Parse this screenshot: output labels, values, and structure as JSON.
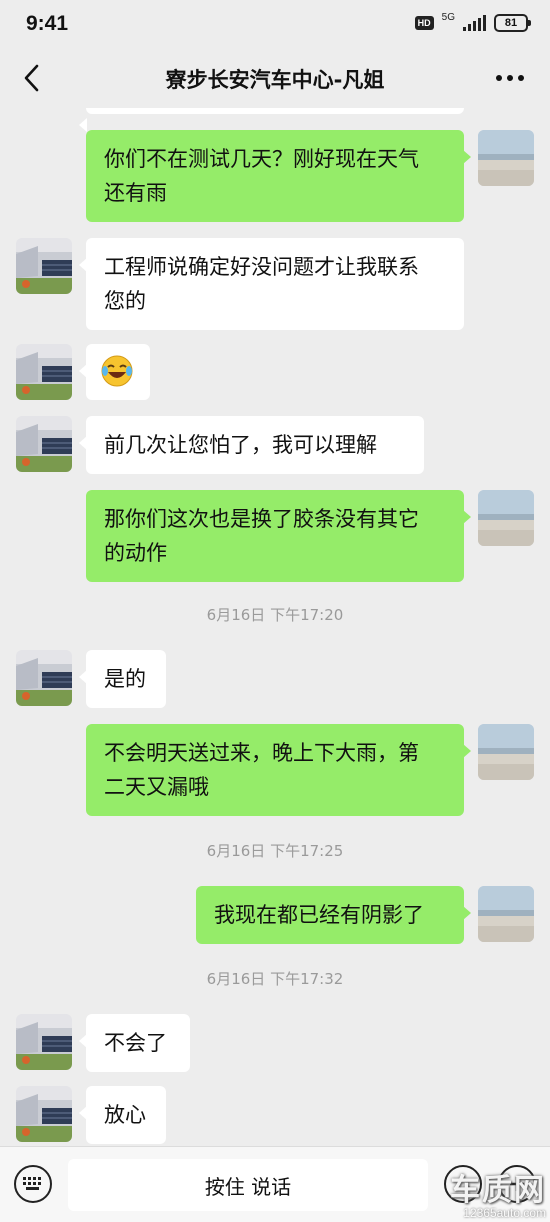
{
  "status_bar": {
    "time": "9:41",
    "hd": "HD",
    "network": "5G",
    "battery": "81"
  },
  "header": {
    "title": "寮步长安汽车中心-凡姐"
  },
  "messages": [
    {
      "dir": "out",
      "lines": [
        "你们不在测试几天？刚好现在天气",
        "还有雨"
      ]
    },
    {
      "dir": "in",
      "lines": [
        "工程师说确定好没问题才让我联系",
        "您的"
      ]
    },
    {
      "dir": "in",
      "lines": [
        "🤣"
      ],
      "emoji": "laughing-crying-emoji"
    },
    {
      "dir": "in",
      "lines": [
        "前几次让您怕了，我可以理解"
      ]
    },
    {
      "dir": "out",
      "lines": [
        "那你们这次也是换了胶条没有其它",
        "的动作"
      ]
    },
    {
      "dir": "in",
      "lines": [
        "是的"
      ]
    },
    {
      "dir": "out",
      "lines": [
        "不会明天送过来，晚上下大雨，第",
        "二天又漏哦"
      ]
    },
    {
      "dir": "out",
      "lines": [
        "我现在都已经有阴影了"
      ]
    },
    {
      "dir": "in",
      "lines": [
        "不会了"
      ]
    },
    {
      "dir": "in",
      "lines": [
        "放心"
      ]
    }
  ],
  "timestamps": [
    "6月16日 下午17:20",
    "6月16日 下午17:25",
    "6月16日 下午17:32"
  ],
  "input_bar": {
    "hold_to_talk": "按住 说话"
  },
  "watermark": {
    "brand": "车质网",
    "site": "12365auto.com"
  },
  "colors": {
    "outgoing_bubble": "#95ec69",
    "incoming_bubble": "#ffffff",
    "background": "#ededed"
  }
}
